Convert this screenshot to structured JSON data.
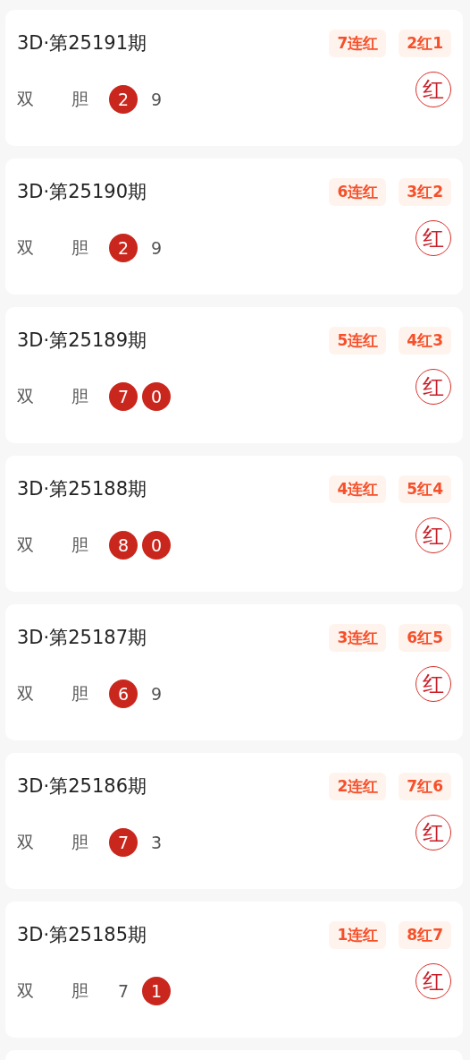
{
  "cards": [
    {
      "title": "3D·第25191期",
      "tags": [
        "7连红",
        "2红1"
      ],
      "labels": [
        "双",
        "胆"
      ],
      "numbers": [
        {
          "value": "2",
          "hit": true
        },
        {
          "value": "9",
          "hit": false
        }
      ],
      "result": "红"
    },
    {
      "title": "3D·第25190期",
      "tags": [
        "6连红",
        "3红2"
      ],
      "labels": [
        "双",
        "胆"
      ],
      "numbers": [
        {
          "value": "2",
          "hit": true
        },
        {
          "value": "9",
          "hit": false
        }
      ],
      "result": "红"
    },
    {
      "title": "3D·第25189期",
      "tags": [
        "5连红",
        "4红3"
      ],
      "labels": [
        "双",
        "胆"
      ],
      "numbers": [
        {
          "value": "7",
          "hit": true
        },
        {
          "value": "0",
          "hit": true
        }
      ],
      "result": "红"
    },
    {
      "title": "3D·第25188期",
      "tags": [
        "4连红",
        "5红4"
      ],
      "labels": [
        "双",
        "胆"
      ],
      "numbers": [
        {
          "value": "8",
          "hit": true
        },
        {
          "value": "0",
          "hit": true
        }
      ],
      "result": "红"
    },
    {
      "title": "3D·第25187期",
      "tags": [
        "3连红",
        "6红5"
      ],
      "labels": [
        "双",
        "胆"
      ],
      "numbers": [
        {
          "value": "6",
          "hit": true
        },
        {
          "value": "9",
          "hit": false
        }
      ],
      "result": "红"
    },
    {
      "title": "3D·第25186期",
      "tags": [
        "2连红",
        "7红6"
      ],
      "labels": [
        "双",
        "胆"
      ],
      "numbers": [
        {
          "value": "7",
          "hit": true
        },
        {
          "value": "3",
          "hit": false
        }
      ],
      "result": "红"
    },
    {
      "title": "3D·第25185期",
      "tags": [
        "1连红",
        "8红7"
      ],
      "labels": [
        "双",
        "胆"
      ],
      "numbers": [
        {
          "value": "7",
          "hit": false
        },
        {
          "value": "1",
          "hit": true
        }
      ],
      "result": "红"
    }
  ]
}
